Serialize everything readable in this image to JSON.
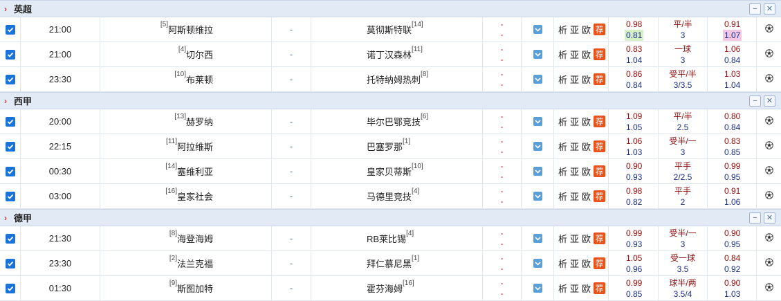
{
  "leagues": [
    {
      "name": "英超",
      "matches": [
        {
          "time": "21:00",
          "home_rank": "[5]",
          "home": "阿斯顿维拉",
          "score": "-",
          "away": "莫彻斯特联",
          "away_rank": "[14]",
          "ho_top": "0.98",
          "ho_bot": "0.81",
          "ho_bot_hl": "green",
          "hcp_top": "平/半",
          "hcp_bot": "3",
          "ao_top": "0.91",
          "ao_bot": "1.07",
          "ao_bot_hl": "pink"
        },
        {
          "time": "21:00",
          "home_rank": "[4]",
          "home": "切尔西",
          "score": "-",
          "away": "诺丁汉森林",
          "away_rank": "[11]",
          "ho_top": "0.83",
          "ho_bot": "1.04",
          "hcp_top": "一球",
          "hcp_bot": "3",
          "ao_top": "1.06",
          "ao_bot": "0.84"
        },
        {
          "time": "23:30",
          "home_rank": "[10]",
          "home": "布莱顿",
          "score": "-",
          "away": "托特纳姆热刺",
          "away_rank": "[8]",
          "ho_top": "0.86",
          "ho_bot": "0.84",
          "hcp_top": "受平/半",
          "hcp_bot": "3/3.5",
          "ao_top": "1.03",
          "ao_bot": "1.04"
        }
      ]
    },
    {
      "name": "西甲",
      "matches": [
        {
          "time": "20:00",
          "home_rank": "[13]",
          "home": "赫罗纳",
          "score": "-",
          "away": "毕尔巴鄂竞技",
          "away_rank": "[6]",
          "ho_top": "1.09",
          "ho_bot": "1.05",
          "hcp_top": "平/半",
          "hcp_bot": "2.5",
          "ao_top": "0.80",
          "ao_bot": "0.84"
        },
        {
          "time": "22:15",
          "home_rank": "[11]",
          "home": "阿拉维斯",
          "score": "-",
          "away": "巴塞罗那",
          "away_rank": "[1]",
          "ho_top": "1.06",
          "ho_bot": "1.03",
          "hcp_top": "受半/一",
          "hcp_bot": "3",
          "ao_top": "0.83",
          "ao_bot": "0.85"
        },
        {
          "time": "00:30",
          "home_rank": "[14]",
          "home": "塞维利亚",
          "score": "-",
          "away": "皇家贝蒂斯",
          "away_rank": "[10]",
          "ho_top": "0.90",
          "ho_bot": "0.93",
          "hcp_top": "平手",
          "hcp_bot": "2/2.5",
          "ao_top": "0.99",
          "ao_bot": "0.95"
        },
        {
          "time": "03:00",
          "home_rank": "[16]",
          "home": "皇家社会",
          "score": "-",
          "away": "马德里竞技",
          "away_rank": "[4]",
          "ho_top": "0.98",
          "ho_bot": "0.82",
          "hcp_top": "平手",
          "hcp_bot": "2",
          "ao_top": "0.91",
          "ao_bot": "1.06"
        }
      ]
    },
    {
      "name": "德甲",
      "matches": [
        {
          "time": "21:30",
          "home_rank": "[8]",
          "home": "海登海姆",
          "score": "-",
          "away": "RB莱比锡",
          "away_rank": "[4]",
          "ho_top": "0.99",
          "ho_bot": "0.93",
          "hcp_top": "受半/一",
          "hcp_bot": "3",
          "ao_top": "0.90",
          "ao_bot": "0.95"
        },
        {
          "time": "23:30",
          "home_rank": "[2]",
          "home": "法兰克福",
          "score": "-",
          "away": "拜仁慕尼黑",
          "away_rank": "[1]",
          "ho_top": "1.05",
          "ho_bot": "0.96",
          "hcp_top": "受一球",
          "hcp_bot": "3.5",
          "ao_top": "0.84",
          "ao_bot": "0.92"
        },
        {
          "time": "01:30",
          "home_rank": "[9]",
          "home": "斯图加特",
          "score": "-",
          "away": "霍芬海姆",
          "away_rank": "[16]",
          "ho_top": "0.99",
          "ho_bot": "0.85",
          "hcp_top": "球半/两",
          "hcp_bot": "3.5/4",
          "ao_top": "0.90",
          "ao_bot": "1.03"
        }
      ]
    }
  ],
  "labels": {
    "half_top": "-",
    "half_bot": "-",
    "link_analysis": "析",
    "link_asia": "亚",
    "link_euro": "欧",
    "recommend_tag": "荐",
    "collapse": "−",
    "close": "✕"
  },
  "colors": {
    "arrow": "#c0392b",
    "checkbox": "#1a73d9",
    "tag": "#e8531c",
    "odds_up": "#8b1010",
    "odds_down": "#1c2f80"
  },
  "icons": {
    "checkbox": "check-icon",
    "dropdown": "chevron-down-icon",
    "ball": "soccer-ball-icon",
    "league_arrow": "chevron-right-icon"
  }
}
